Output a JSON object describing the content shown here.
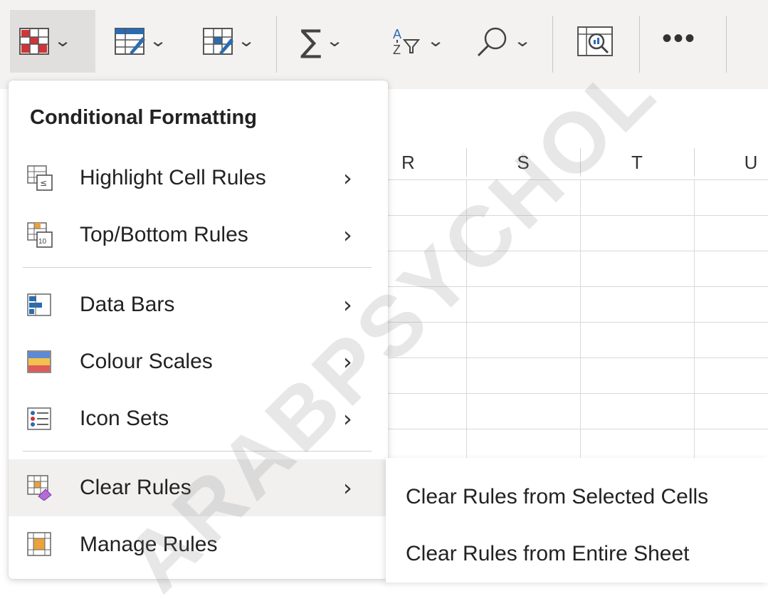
{
  "toolbar": {
    "conditional_formatting": "conditional-formatting-icon",
    "format_as_table": "format-as-table-icon",
    "cell_styles": "cell-styles-icon",
    "autosum": "∑",
    "sort_filter": "sort-filter-icon",
    "find": "find-icon",
    "analyze_data": "analyze-data-icon",
    "more": "•••"
  },
  "columns": [
    "R",
    "S",
    "T",
    "U"
  ],
  "menu": {
    "title": "Conditional Formatting",
    "items": [
      {
        "label": "Highlight Cell Rules",
        "icon": "highlight-cell-rules-icon"
      },
      {
        "label": "Top/Bottom Rules",
        "icon": "top-bottom-rules-icon"
      },
      {
        "label": "Data Bars",
        "icon": "data-bars-icon"
      },
      {
        "label": "Colour Scales",
        "icon": "colour-scales-icon"
      },
      {
        "label": "Icon Sets",
        "icon": "icon-sets-icon"
      },
      {
        "label": "Clear Rules",
        "icon": "clear-rules-icon"
      },
      {
        "label": "Manage Rules",
        "icon": "manage-rules-icon"
      }
    ],
    "arrow": "›"
  },
  "submenu": {
    "items": [
      {
        "label": "Clear Rules from Selected Cells"
      },
      {
        "label": "Clear Rules from Entire Sheet"
      }
    ]
  },
  "watermark": "ARABPSYCHOL",
  "colors": {
    "toolbar_bg": "#f3f2f1",
    "hover_bg": "#f1f0ef",
    "accent_red": "#d13438",
    "accent_blue": "#2b6cb0"
  }
}
